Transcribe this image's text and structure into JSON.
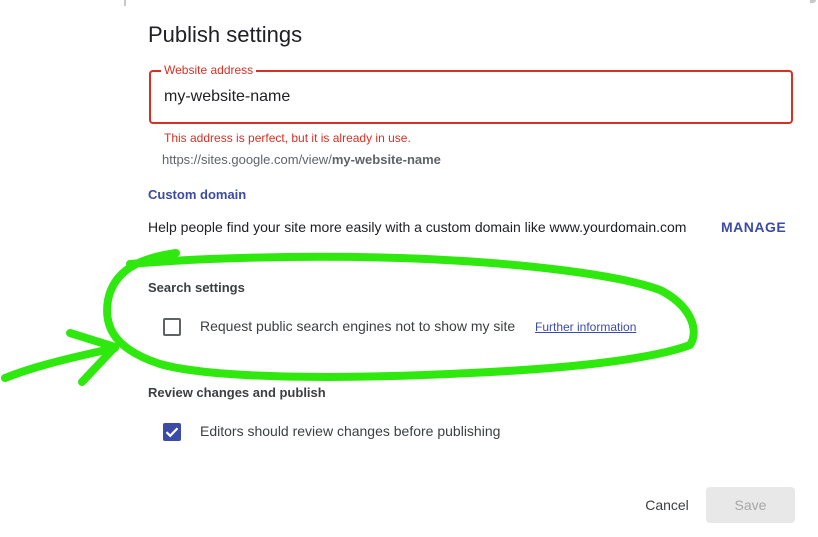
{
  "dialog": {
    "title": "Publish settings",
    "website_address": {
      "label": "Website address",
      "value": "my-website-name",
      "error": "This address is perfect, but it is already in use.",
      "url_prefix": "https://sites.google.com/view/",
      "url_name": "my-website-name"
    },
    "custom_domain": {
      "title": "Custom domain",
      "help": "Help people find your site more easily with a custom domain like www.yourdomain.com",
      "manage_label": "MANAGE"
    },
    "search_settings": {
      "title": "Search settings",
      "checkbox_label": "Request public search engines not to show my site",
      "checked": false,
      "link_label": "Further information"
    },
    "review": {
      "title": "Review changes and publish",
      "checkbox_label": "Editors should review changes before publishing",
      "checked": true
    },
    "buttons": {
      "cancel_label": "Cancel",
      "save_label": "Save",
      "save_disabled": true
    }
  },
  "colors": {
    "accent": "#3c4ba6",
    "error": "#d93025",
    "annotation": "#2ee80e"
  },
  "annotation": {
    "shape": "hand-drawn-circle-with-arrow",
    "target": "search-settings"
  }
}
